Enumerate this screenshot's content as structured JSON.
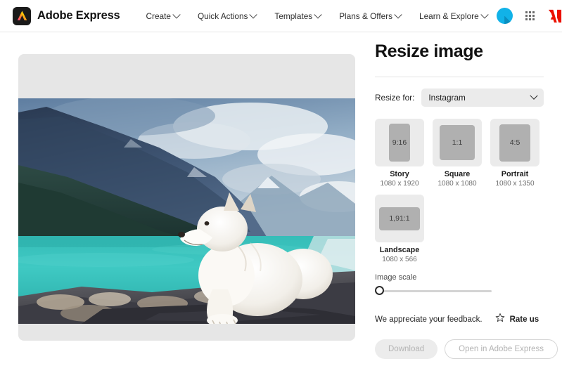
{
  "header": {
    "brand_name": "Adobe Express",
    "brand_icon": "adobe-express-logo-icon",
    "nav": [
      {
        "label": "Create"
      },
      {
        "label": "Quick Actions"
      },
      {
        "label": "Templates"
      },
      {
        "label": "Plans & Offers"
      },
      {
        "label": "Learn & Explore"
      }
    ],
    "avatar_icon": "user-avatar",
    "app_switcher_icon": "app-grid-icon",
    "adobe_icon": "adobe-logo-icon"
  },
  "preview": {
    "alt": "Turquoise mountain lake with a white Samoyed dog resting on dark rocks"
  },
  "panel": {
    "title": "Resize image",
    "resize_for_label": "Resize for:",
    "select_value": "Instagram",
    "select_chevron_icon": "chevron-down-icon",
    "presets": [
      {
        "ratio": "9:16",
        "name": "Story",
        "dims": "1080 x 1920"
      },
      {
        "ratio": "1:1",
        "name": "Square",
        "dims": "1080 x 1080"
      },
      {
        "ratio": "4:5",
        "name": "Portrait",
        "dims": "1080 x 1350"
      },
      {
        "ratio": "1,91:1",
        "name": "Landscape",
        "dims": "1080 x 566"
      }
    ],
    "scale_label": "Image scale",
    "scale_value": 0,
    "feedback_text": "We appreciate your feedback.",
    "rate_label": "Rate us",
    "rate_icon": "star-outline-icon",
    "download_label": "Download",
    "open_label": "Open in Adobe Express"
  },
  "colors": {
    "accent_cyan": "#11b2e8",
    "adobe_red": "#eb1000",
    "canvas_bg": "#e6e6e6",
    "preset_box": "#ebebeb",
    "preset_thumb": "#b0b0b0",
    "lake": "#3fc6c0"
  }
}
